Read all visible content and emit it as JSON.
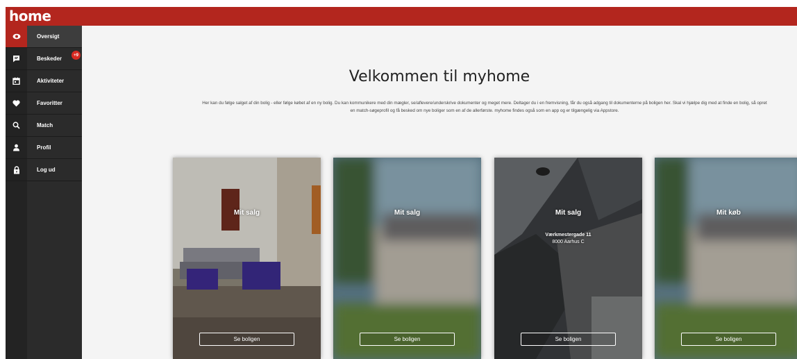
{
  "app": {
    "logo": "home"
  },
  "sidebar": {
    "items": [
      {
        "label": "Oversigt",
        "icon": "eye-icon",
        "active": true
      },
      {
        "label": "Beskeder",
        "icon": "message-icon",
        "badge": "+9"
      },
      {
        "label": "Aktiviteter",
        "icon": "calendar-icon"
      },
      {
        "label": "Favoritter",
        "icon": "heart-icon"
      },
      {
        "label": "Match",
        "icon": "search-icon"
      },
      {
        "label": "Profil",
        "icon": "user-icon"
      },
      {
        "label": "Log ud",
        "icon": "lock-icon"
      }
    ]
  },
  "main": {
    "title": "Velkommen til myhome",
    "intro": "Her kan du følge salget af din bolig - eller følge købet af en ny bolig. Du kan kommunikere med din mægler, se/aflevere/underskrive dokumenter og meget mere. Deltager du i en fremvisning, får du også adgang til dokumenterne på boligen her. Skal vi hjælpe dig med at finde en bolig, så opret en match-søgeprofil og få besked om nye boliger som en af de allerførste. myhome findes også som en app og er tilgængelig via Appstore.",
    "cards": [
      {
        "title": "Mit salg",
        "button": "Se boligen"
      },
      {
        "title": "Mit salg",
        "button": "Se boligen"
      },
      {
        "title": "Mit salg",
        "address_street": "Værkmestergade 11",
        "address_city": "8000 Aarhus C",
        "button": "Se boligen"
      },
      {
        "title": "Mit køb",
        "button": "Se boligen"
      }
    ]
  },
  "colors": {
    "brand": "#b3261e",
    "sidebar": "#2b2b2b",
    "background": "#f4f4f4"
  }
}
